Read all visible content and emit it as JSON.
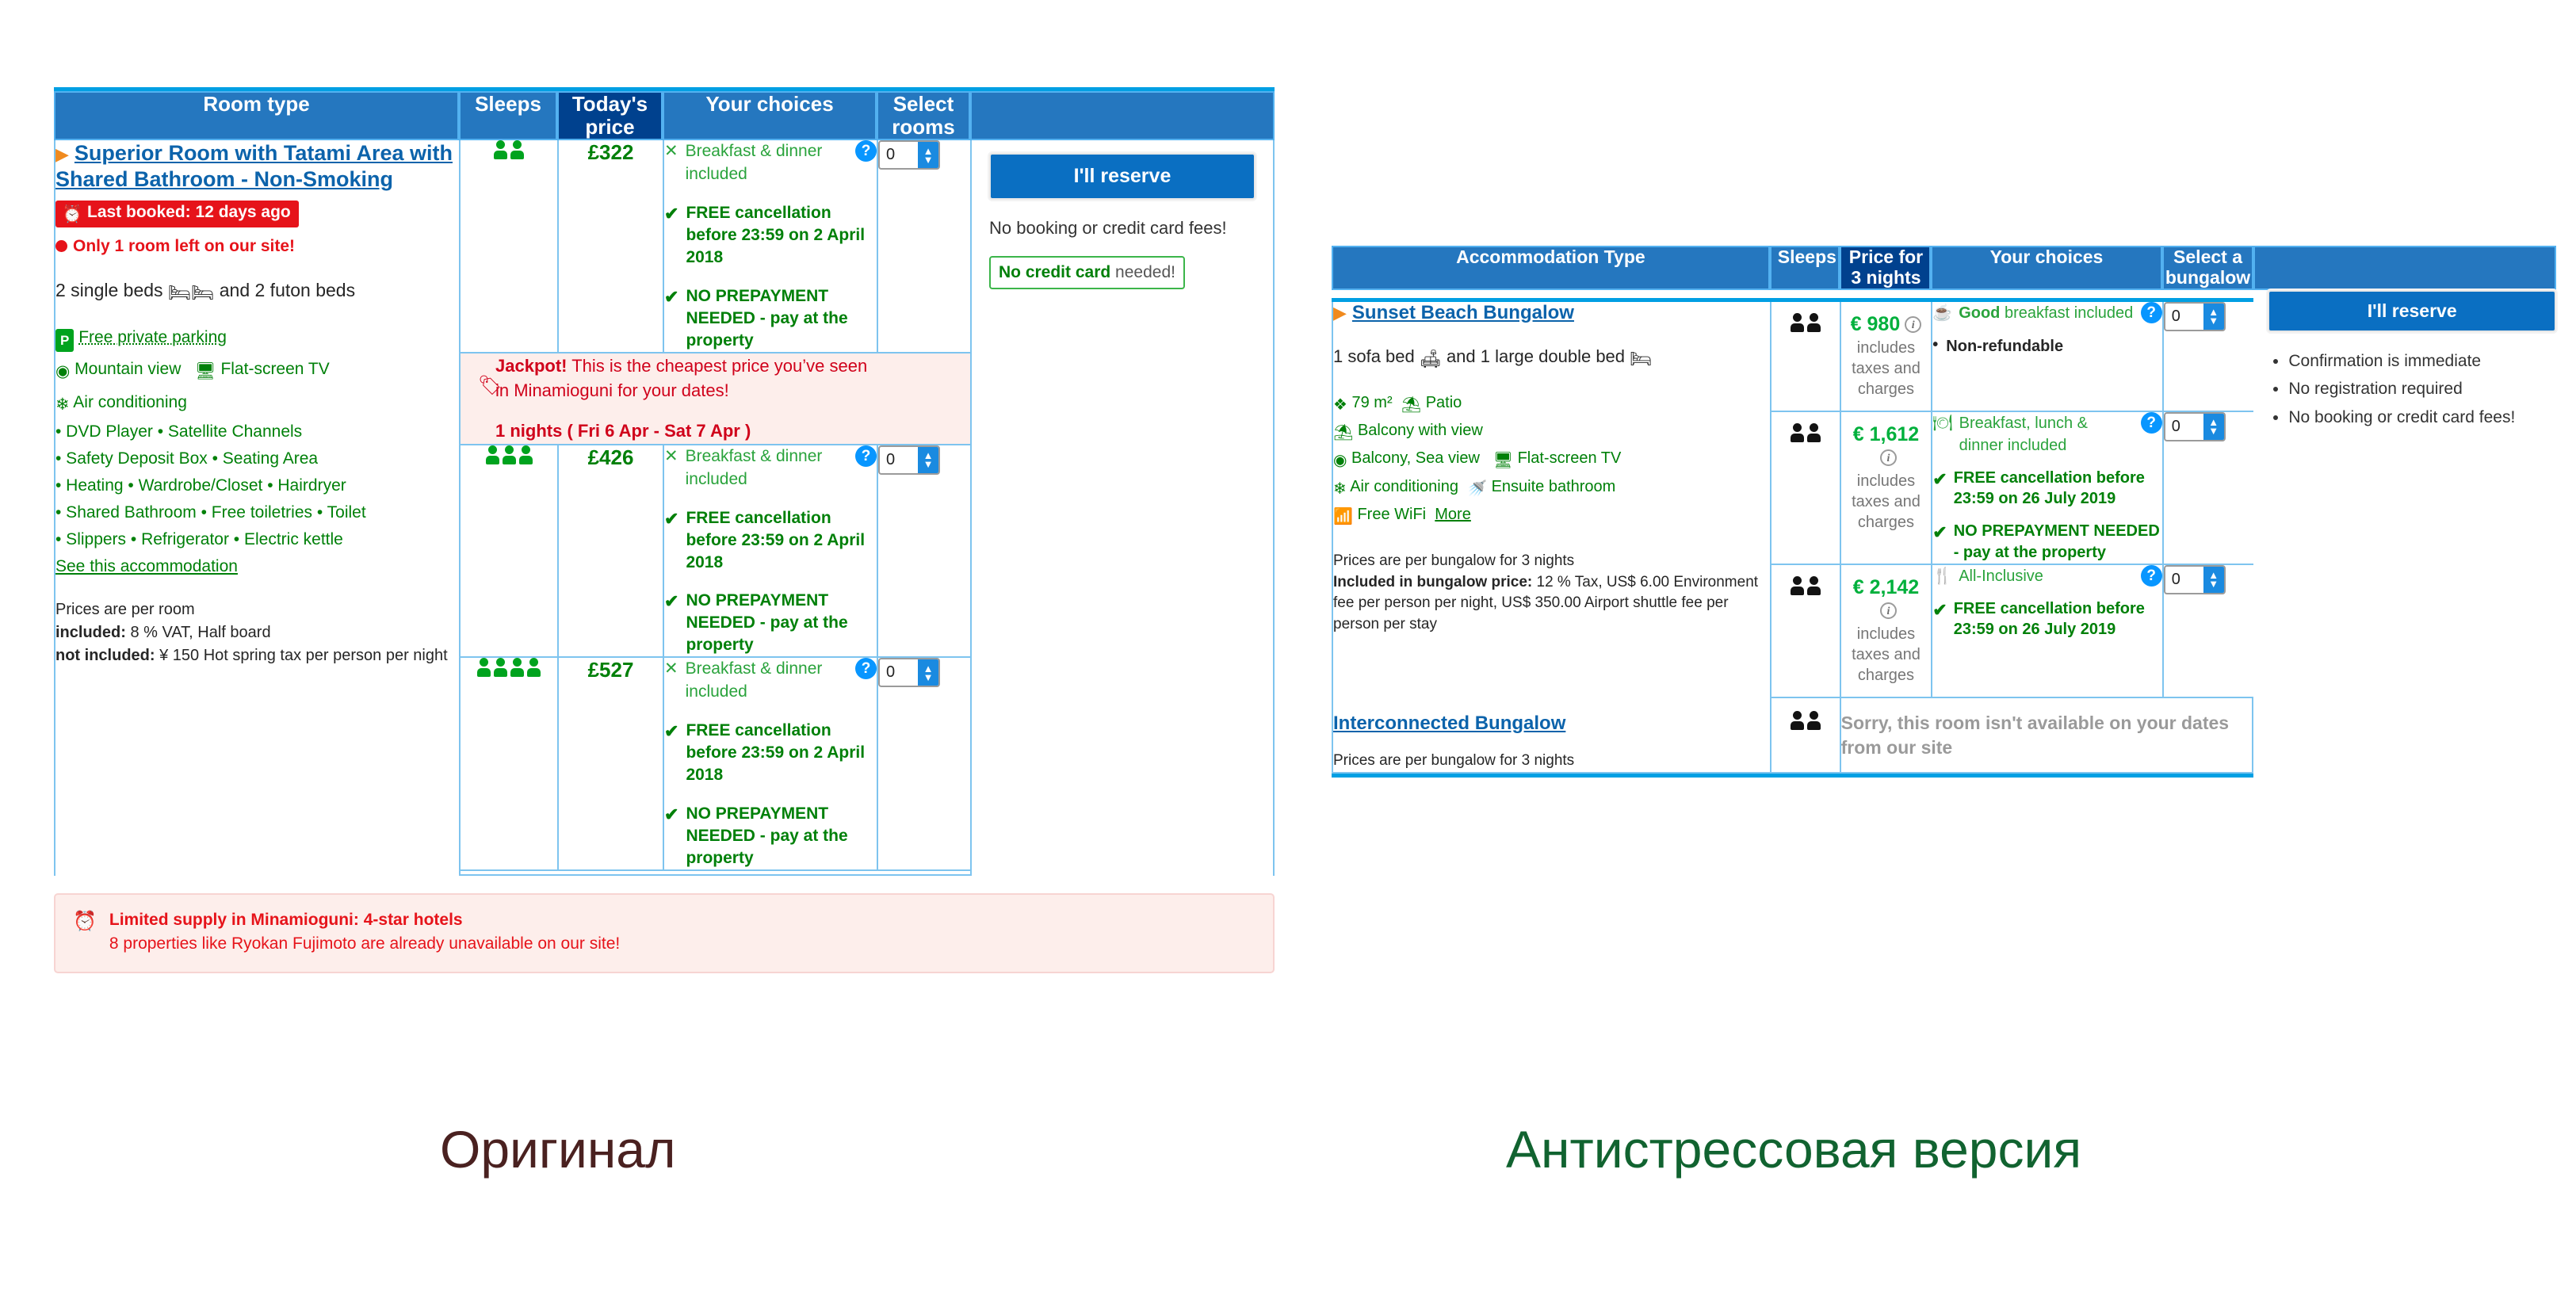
{
  "captions": {
    "left": "Оригинал",
    "right": "Антистрессовая версия"
  },
  "left_table": {
    "headers": {
      "room_type": "Room type",
      "sleeps": "Sleeps",
      "price": "Today's price",
      "choices": "Your choices",
      "select": "Select rooms",
      "blank": ""
    },
    "room": {
      "title": "Superior Room with Tatami Area with Shared Bathroom - Non-Smoking",
      "last_booked_badge": "Last booked: 12 days ago",
      "only_left": "Only 1 room left on our site!",
      "beds": "2 single beds",
      "beds_tail": "and 2 futon beds",
      "parking": "Free private parking",
      "features_inline": [
        "Mountain view",
        "Flat-screen TV",
        "Air conditioning"
      ],
      "features_bullets": [
        "• DVD Player  • Satellite Channels",
        "• Safety Deposit Box  • Seating Area",
        "• Heating  • Wardrobe/Closet  • Hairdryer",
        "• Shared Bathroom  • Free toiletries  • Toilet",
        "• Slippers  • Refrigerator  • Electric kettle"
      ],
      "see_accommodation": "See this accommodation",
      "prices_are": "Prices are per room",
      "included_label": "included:",
      "included_value": " 8 % VAT, Half board",
      "not_included_label": "not included:",
      "not_included_value": " ¥ 150 Hot spring tax per person per night"
    },
    "rows": [
      {
        "sleeps": 2,
        "price": "£322",
        "meal": "Breakfast & dinner included",
        "cancel": "FREE cancellation before 23:59 on 2 April 2018",
        "prepay": "NO PREPAYMENT NEEDED - pay at the property",
        "select_value": "0",
        "help": "?"
      },
      {
        "sleeps": 3,
        "price": "£426",
        "meal": "Breakfast & dinner included",
        "cancel": "FREE cancellation before 23:59 on 2 April 2018",
        "prepay": "NO PREPAYMENT NEEDED - pay at the property",
        "select_value": "0",
        "help": "?"
      },
      {
        "sleeps": 4,
        "price": "£527",
        "meal": "Breakfast & dinner included",
        "cancel": "FREE cancellation before 23:59 on 2 April 2018",
        "prepay": "NO PREPAYMENT NEEDED - pay at the property",
        "select_value": "0",
        "help": "?"
      }
    ],
    "reserve": {
      "button": "I'll reserve",
      "no_fees": "No booking or credit card fees!",
      "no_cc_bold": "No credit card",
      "no_cc_rest": " needed!"
    },
    "jackpot": {
      "bold": "Jackpot!",
      "text": " This is the cheapest price you’ve seen in Minamioguni for your dates!",
      "nights": "1 nights ( Fri 6 Apr - Sat 7 Apr )"
    },
    "limited": {
      "title": "Limited supply in Minamioguni: 4-star hotels",
      "body": "8 properties like Ryokan Fujimoto are already unavailable on our site!"
    }
  },
  "right_table": {
    "headers": {
      "accommodation": "Accommodation Type",
      "sleeps": "Sleeps",
      "price": "Price for 3 nights",
      "choices": "Your choices",
      "select": "Select a bungalow",
      "blank": ""
    },
    "bungalow": {
      "title": "Sunset Beach Bungalow",
      "beds_head": "1 sofa bed",
      "beds_mid": "and 1 large double bed",
      "size": "79 m²",
      "patio": "Patio",
      "balcony_view": "Balcony with view",
      "view": "Balcony, Sea view",
      "tv": "Flat-screen TV",
      "ac": "Air conditioning",
      "bathroom": "Ensuite bathroom",
      "wifi": "Free WiFi",
      "more": "More",
      "prices_are": "Prices are per bungalow for 3 nights",
      "included_label": "Included in bungalow price:",
      "included_value": " 12 % Tax, US$ 6.00 Environment fee per person per night, US$ 350.00 Airport shuttle fee per person per stay"
    },
    "rows": [
      {
        "sleeps": 2,
        "price": "€ 980",
        "price_note": "includes taxes and charges",
        "meal_bold": "Good",
        "meal_rest": " breakfast included",
        "bullets": [
          "Non-refundable"
        ],
        "checks": [],
        "select_value": "0",
        "help": "?"
      },
      {
        "sleeps": 2,
        "price": "€ 1,612",
        "price_note": "includes taxes and charges",
        "meal_bold": "",
        "meal_rest": "Breakfast, lunch & dinner included",
        "bullets": [],
        "checks": [
          "FREE cancellation before 23:59 on 26 July 2019",
          "NO PREPAYMENT NEEDED - pay at the property"
        ],
        "select_value": "0",
        "help": "?"
      },
      {
        "sleeps": 2,
        "price": "€ 2,142",
        "price_note": "includes taxes and charges",
        "meal_bold": "",
        "meal_rest": "All-Inclusive",
        "bullets": [],
        "checks": [
          "FREE cancellation before 23:59 on 26 July 2019"
        ],
        "select_value": "0",
        "help": "?"
      }
    ],
    "second_room": {
      "title": "Interconnected Bungalow",
      "note": "Prices are per bungalow for 3 nights",
      "unavailable": "Sorry, this room isn't available on your dates from our site"
    },
    "reserve": {
      "button": "I'll reserve",
      "benefits": [
        "Confirmation is immediate",
        "No registration required",
        "No booking or credit card fees!"
      ]
    }
  },
  "colors": {
    "header_blue": "#2577bf",
    "price_header_blue": "#00418e",
    "accent_cyan": "#009fe3",
    "green": "#008009",
    "red": "#e6131a",
    "link_blue": "#0c63ab"
  }
}
